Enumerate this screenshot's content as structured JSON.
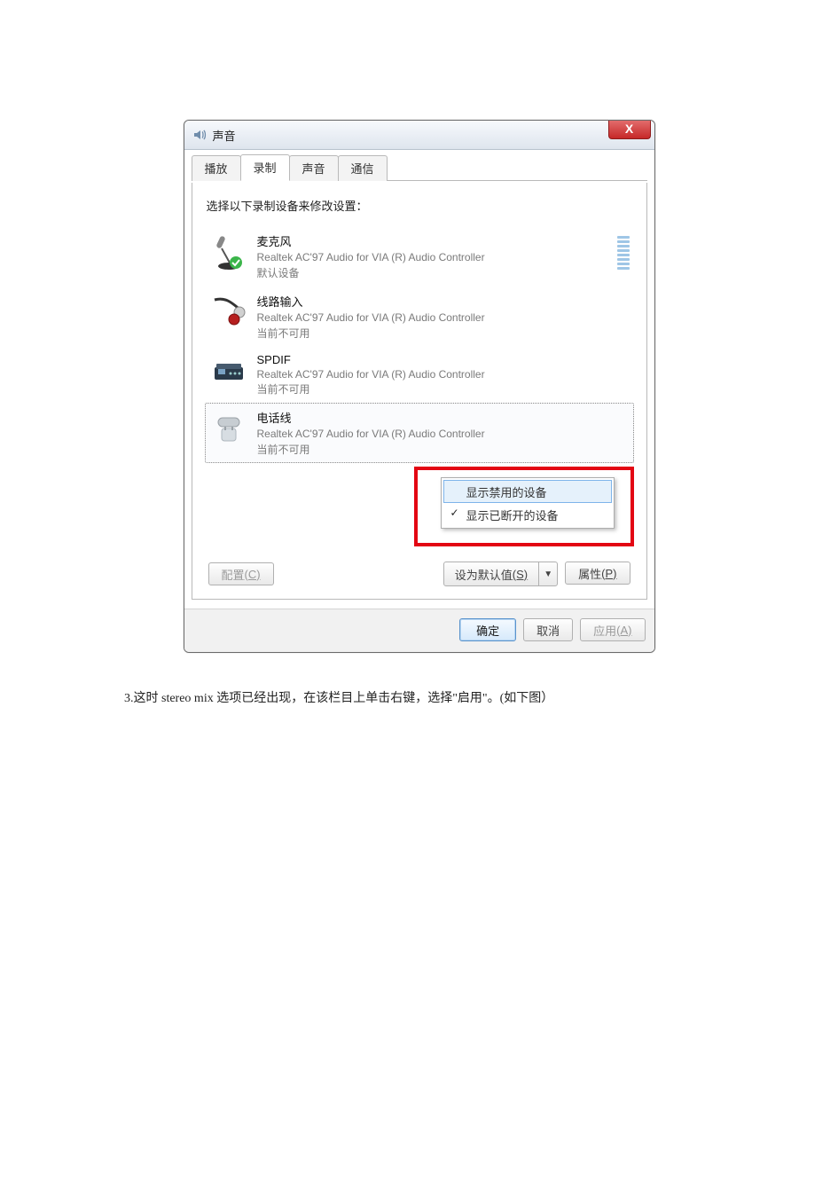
{
  "dialog": {
    "title": "声音",
    "close_symbol": "X",
    "tabs": [
      "播放",
      "录制",
      "声音",
      "通信"
    ],
    "active_tab_index": 1,
    "instruction": "选择以下录制设备来修改设置：",
    "devices": [
      {
        "name": "麦克风",
        "sub": "Realtek AC'97 Audio for VIA (R) Audio Controller",
        "status": "默认设备",
        "has_level": true,
        "selected": false
      },
      {
        "name": "线路输入",
        "sub": "Realtek AC'97 Audio for VIA (R) Audio Controller",
        "status": "当前不可用",
        "has_level": false,
        "selected": false
      },
      {
        "name": "SPDIF",
        "sub": "Realtek AC'97 Audio for VIA (R) Audio Controller",
        "status": "当前不可用",
        "has_level": false,
        "selected": false
      },
      {
        "name": "电话线",
        "sub": "Realtek AC'97 Audio for VIA (R) Audio Controller",
        "status": "当前不可用",
        "has_level": false,
        "selected": true
      }
    ],
    "context_menu": {
      "items": [
        {
          "label": "显示禁用的设备",
          "checked": false,
          "hovered": true
        },
        {
          "label": "显示已断开的设备",
          "checked": true,
          "hovered": false
        }
      ]
    },
    "buttons": {
      "configure": {
        "label": "配置",
        "hotkey": "(C)"
      },
      "set_default": {
        "label": "设为默认值",
        "hotkey": "(S)"
      },
      "properties": {
        "label": "属性",
        "hotkey": "(P)"
      },
      "ok": "确定",
      "cancel": "取消",
      "apply": {
        "label": "应用",
        "hotkey": "(A)"
      }
    }
  },
  "caption_step3": "3.这时 stereo  mix 选项已经出现，在该栏目上单击右键，选择\"启用\"。(如下图）"
}
